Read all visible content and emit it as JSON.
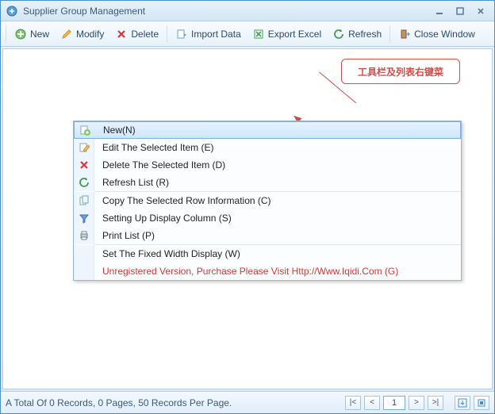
{
  "window": {
    "title": "Supplier Group Management"
  },
  "toolbar": {
    "new": "New",
    "modify": "Modify",
    "delete": "Delete",
    "import": "Import Data",
    "export": "Export Excel",
    "refresh": "Refresh",
    "close": "Close Window"
  },
  "callout": {
    "text": "工具栏及列表右键菜"
  },
  "context_menu": {
    "items": [
      {
        "label": "New(N)",
        "icon": "new"
      },
      {
        "label": "Edit The Selected Item (E)",
        "icon": "edit"
      },
      {
        "label": "Delete The Selected Item (D)",
        "icon": "delete"
      },
      {
        "label": "Refresh List  (R)",
        "icon": "refresh"
      },
      {
        "sep": true
      },
      {
        "label": "Copy The Selected Row Information (C)",
        "icon": "copy"
      },
      {
        "label": "Setting Up Display Column (S)",
        "icon": "filter"
      },
      {
        "label": "Print List (P)",
        "icon": "print"
      },
      {
        "sep": true
      },
      {
        "label": "Set The Fixed Width Display (W)",
        "icon": ""
      },
      {
        "label": "Unregistered Version, Purchase Please Visit Http://Www.Iqidi.Com  (G)",
        "icon": "",
        "red": true
      }
    ]
  },
  "status": {
    "text": "A Total Of 0 Records, 0 Pages, 50 Records Per Page.",
    "page": "1"
  },
  "colors": {
    "accent": "#4a90c8",
    "danger": "#d34d48"
  }
}
